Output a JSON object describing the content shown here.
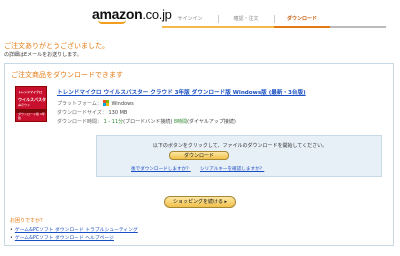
{
  "header": {
    "logo_text": "amazon",
    "logo_suffix": ".co.jp"
  },
  "steps": [
    {
      "label": "サインイン"
    },
    {
      "label": "確認・注文"
    },
    {
      "label": "ダウンロード"
    }
  ],
  "progress": {
    "completed_steps": 3,
    "active_step": 3
  },
  "thanks": "ご注文ありがとうございました。",
  "email_note": "の詳細はEメールをお送りします。",
  "main": {
    "title": "ご注文商品をダウンロードできます",
    "product": {
      "image": {
        "line1": "トレンドマイクロ",
        "line2": "ウイルスバスター",
        "line3": "クラウド",
        "label": "ダウンロード版 3年版"
      },
      "title": "トレンドマイクロ ウイルスバスター クラウド 3年版 ダウンロード版 Windows版 (最新・3台版)",
      "platform_label": "プラットフォーム：",
      "platform_value": "Windows",
      "size_label": "ダウンロードサイズ：",
      "size_value": "130 MB",
      "time_label": "ダウンロード時間：",
      "time_value1": "1 - 11分",
      "time_value1_note": "(ブロードバンド接続) ",
      "time_value2": "8時間",
      "time_value2_note": "(ダイヤルアップ接続)"
    },
    "download_panel": {
      "instruction": "以下のボタンをクリックして、ファイルのダウンロードを開始してください。",
      "button_label": "ダウンロード",
      "link_later": "後でダウンロードしますか？",
      "link_serial": "シリアルキーを確認しますか？"
    },
    "shop_button_label": "ショッピングを続ける ▸",
    "help": {
      "title": "お困りですか？",
      "links": [
        "ゲーム&PCソフト ダウンロード トラブルシューティング",
        "ゲーム&PCソフト ダウンロード ヘルプページ"
      ]
    }
  },
  "colors": {
    "accent_orange": "#e47911",
    "link_blue": "#1a4ec2",
    "panel_bg": "#e7eff7",
    "button_gold": "#f0c14b"
  }
}
